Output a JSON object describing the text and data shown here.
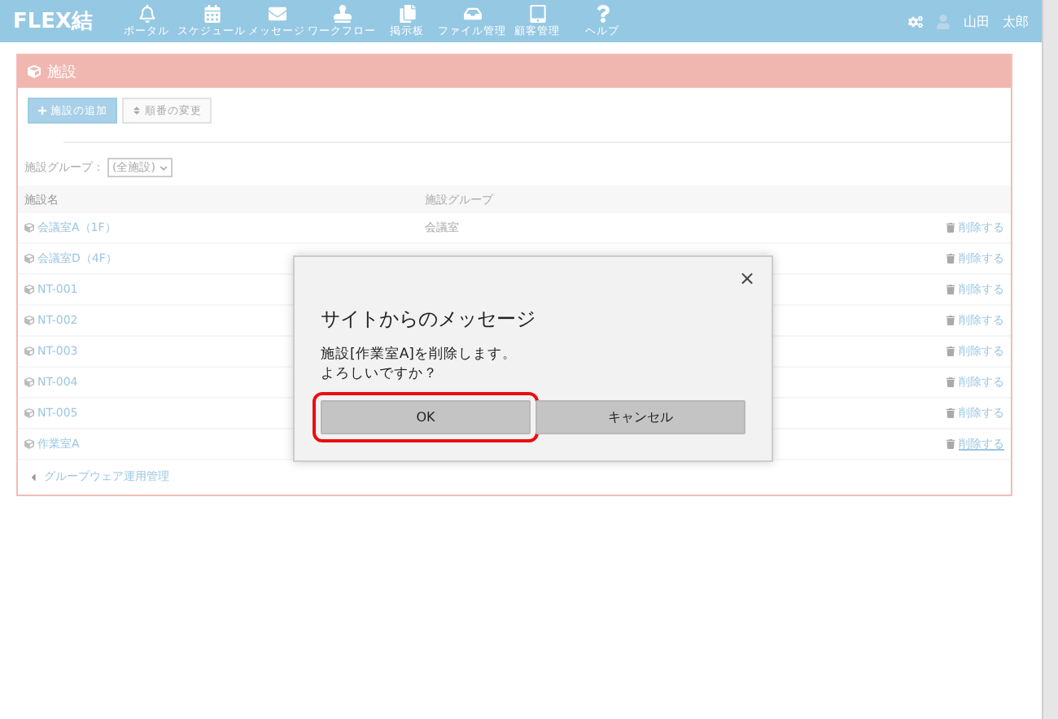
{
  "header": {
    "logo": "FLEX結",
    "nav": [
      {
        "label": "ポータル",
        "kind": "bell"
      },
      {
        "label": "スケジュール",
        "kind": "calendar"
      },
      {
        "label": "メッセージ",
        "kind": "mail"
      },
      {
        "label": "ワークフロー",
        "kind": "stamp"
      },
      {
        "label": "掲示板",
        "kind": "board"
      },
      {
        "label": "ファイル管理",
        "kind": "inbox"
      },
      {
        "label": "顧客管理",
        "kind": "tablet"
      },
      {
        "label": "ヘルプ",
        "kind": "help"
      }
    ],
    "user": "山田　太郎"
  },
  "panel": {
    "title": "施設",
    "toolbar": [
      {
        "label": "施設の追加",
        "kind": "primary"
      },
      {
        "label": "順番の変更",
        "kind": "default"
      }
    ],
    "filter": {
      "label": "施設グループ：",
      "value": "(全施設)"
    },
    "table": {
      "columns": [
        "施設名",
        "施設グループ"
      ],
      "rows": [
        {
          "name": "会議室A（1F）",
          "group": "会議室",
          "action": "削除する",
          "hovered": false
        },
        {
          "name": "会議室D（4F）",
          "action": "削除する",
          "hovered": false
        },
        {
          "name": "NT-001",
          "action": "削除する",
          "hovered": false
        },
        {
          "name": "NT-002",
          "action": "削除する",
          "hovered": false
        },
        {
          "name": "NT-003",
          "action": "削除する",
          "hovered": false
        },
        {
          "name": "NT-004",
          "action": "削除する",
          "hovered": false
        },
        {
          "name": "NT-005",
          "action": "削除する",
          "hovered": false
        },
        {
          "name": "作業室A",
          "action": "削除する",
          "hovered": true
        }
      ]
    },
    "back_link": "グループウェア運用管理"
  },
  "dialog": {
    "title": "サイトからのメッセージ",
    "close": "×",
    "message": [
      "施設[作業室A]を削除します。",
      "よろしいですか？"
    ],
    "buttons": [
      {
        "label": "OK",
        "highlighted": true
      },
      {
        "label": "キャンセル",
        "highlighted": false
      }
    ]
  }
}
